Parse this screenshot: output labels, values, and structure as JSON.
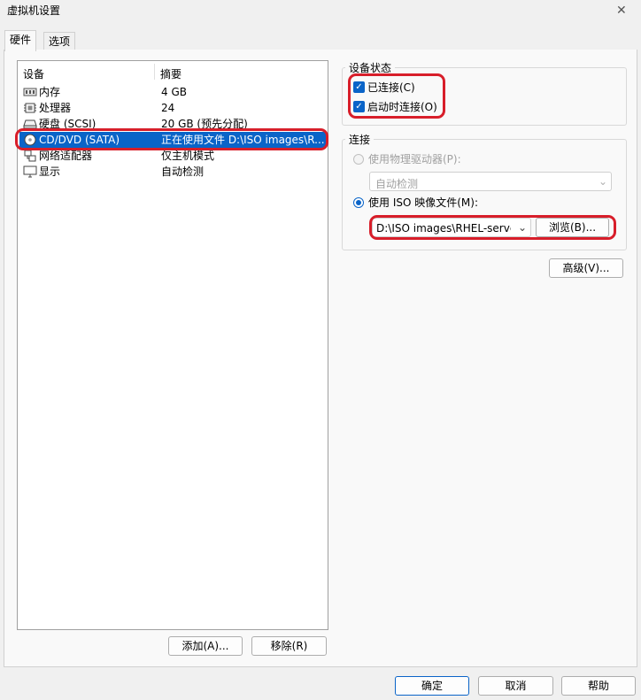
{
  "window": {
    "title": "虚拟机设置"
  },
  "tabs": [
    {
      "label": "硬件",
      "active": true
    },
    {
      "label": "选项",
      "active": false
    }
  ],
  "device_list": {
    "columns": [
      "设备",
      "摘要"
    ],
    "rows": [
      {
        "name": "内存",
        "summary": "4 GB",
        "icon": "memory-icon",
        "selected": false
      },
      {
        "name": "处理器",
        "summary": "24",
        "icon": "processor-icon",
        "selected": false
      },
      {
        "name": "硬盘 (SCSI)",
        "summary": "20 GB (预先分配)",
        "icon": "hard-disk-icon",
        "selected": false
      },
      {
        "name": "CD/DVD (SATA)",
        "summary": "正在使用文件 D:\\ISO images\\R...",
        "icon": "cd-dvd-icon",
        "selected": true
      },
      {
        "name": "网络适配器",
        "summary": "仅主机模式",
        "icon": "network-adapter-icon",
        "selected": false
      },
      {
        "name": "显示",
        "summary": "自动检测",
        "icon": "display-icon",
        "selected": false
      }
    ]
  },
  "list_buttons": {
    "add": "添加(A)...",
    "remove": "移除(R)"
  },
  "device_status": {
    "title": "设备状态",
    "connected": {
      "label": "已连接(C)",
      "checked": true
    },
    "connect_at_power_on": {
      "label": "启动时连接(O)",
      "checked": true
    }
  },
  "connection": {
    "title": "连接",
    "physical": {
      "label": "使用物理驱动器(P):",
      "selected": false,
      "dropdown_value": "自动检测"
    },
    "iso": {
      "label": "使用 ISO 映像文件(M):",
      "selected": true,
      "path": "D:\\ISO images\\RHEL-server-"
    },
    "browse": "浏览(B)..."
  },
  "advanced_button": "高级(V)...",
  "footer": {
    "ok": "确定",
    "cancel": "取消",
    "help": "帮助"
  },
  "colors": {
    "accent": "#0a64c8",
    "highlight_ring": "#d81e2a"
  }
}
